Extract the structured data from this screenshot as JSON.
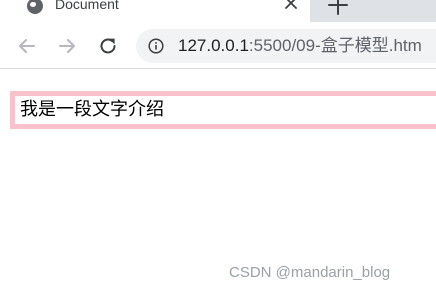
{
  "browser": {
    "tab": {
      "title": "Document",
      "favicon": "globe-icon",
      "close_icon": "close-icon"
    },
    "new_tab_icon": "plus-icon",
    "toolbar": {
      "back_icon": "arrow-left-icon",
      "forward_icon": "arrow-right-icon",
      "reload_icon": "reload-icon",
      "info_icon": "info-icon"
    },
    "address": {
      "host": "127.0.0.1",
      "path": ":5500/09-盒子模型.htm"
    }
  },
  "page": {
    "intro_text": "我是一段文字介绍",
    "box_border_color": "#f8c1cc"
  },
  "watermark": "CSDN @mandarin_blog"
}
